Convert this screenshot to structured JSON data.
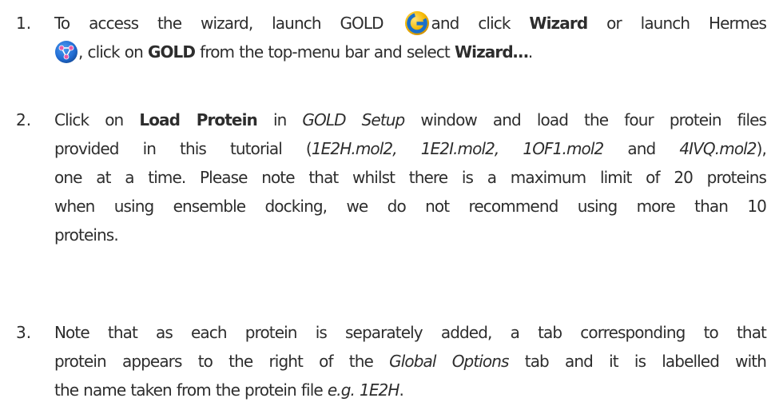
{
  "steps": [
    {
      "number": "1.",
      "line1": {
        "t1": "To access the wizard, launch GOLD",
        "t2": "and click",
        "b1": "Wizard",
        "t3": "or launch Hermes"
      },
      "line2": {
        "t1": ", click on",
        "b1": "GOLD",
        "t2": "from the top-menu bar and select",
        "b2": "Wizard…",
        "t3": "."
      }
    },
    {
      "number": "2.",
      "line1": {
        "t1": "Click on",
        "b1": "Load Protein",
        "t2": "in",
        "i1": "GOLD Setup",
        "t3": "window and load the four protein files"
      },
      "line2": {
        "t1": "provided in this tutorial (",
        "i1": "1E2H.mol2, 1E2I.mol2, 1OF1.mol2",
        "t2": "and",
        "i2": "4IVQ.mol2",
        "t3": "),"
      },
      "line3": "one at a time.  Please note that whilst there is a maximum limit of 20 proteins",
      "line4": "when using ensemble docking, we do not recommend using more than 10",
      "line5": "proteins."
    },
    {
      "number": "3.",
      "line1": "Note that as each protein is separately added, a tab corresponding to that",
      "line2": {
        "t1": "protein appears to the right of the",
        "i1": "Global Options",
        "t2": "tab and it is labelled with"
      },
      "line3": {
        "t1": "the name taken from the protein file",
        "i1": "e.g. 1E2H",
        "t2": "."
      }
    }
  ],
  "icons": {
    "gold": "gold-app-icon",
    "hermes": "hermes-app-icon"
  },
  "colors": {
    "text": "#2d2d2d",
    "gold_icon": "#f5b800",
    "gold_letter": "#1a6fc9",
    "hermes_icon": "#1f6ad1"
  }
}
